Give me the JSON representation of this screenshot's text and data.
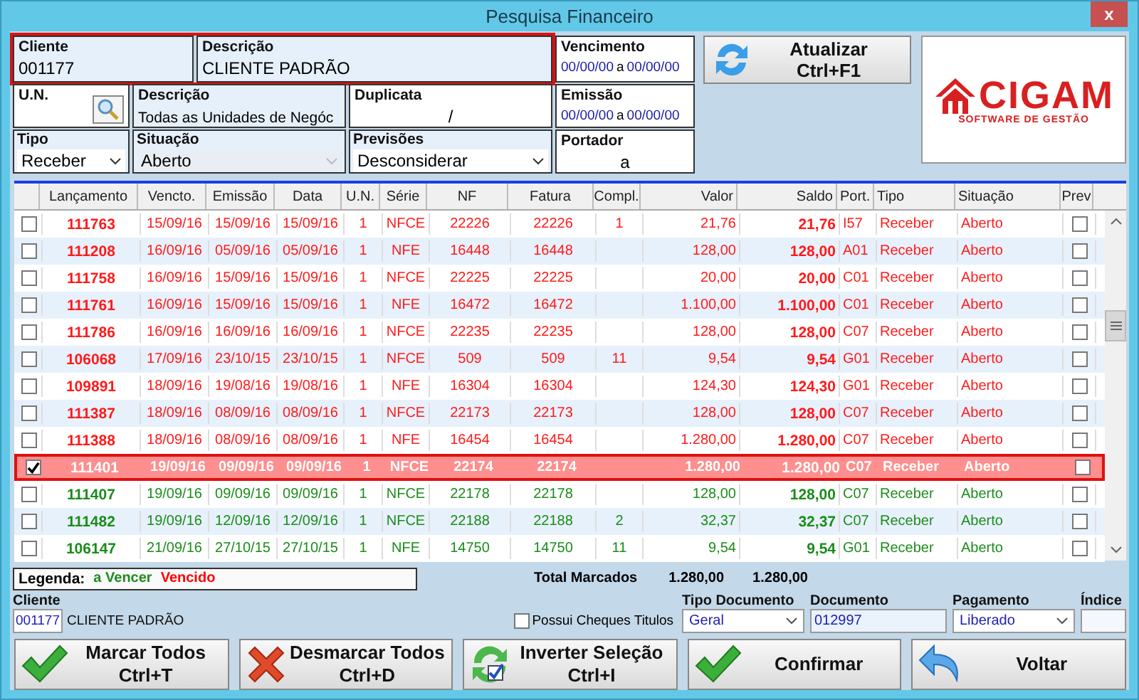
{
  "window": {
    "title": "Pesquisa Financeiro",
    "close": "x"
  },
  "filters": {
    "cliente": {
      "label": "Cliente",
      "value": "001177",
      "highlighted": true
    },
    "descricao": {
      "label": "Descrição",
      "value": "CLIENTE PADRÃO"
    },
    "vencimento": {
      "label": "Vencimento",
      "from": "00/00/00",
      "sep": "a",
      "to": "00/00/00"
    },
    "un": {
      "label": "U.N."
    },
    "un_descricao": {
      "label": "Descrição",
      "value": "Todas as Unidades de Negóc"
    },
    "duplicata": {
      "label": "Duplicata",
      "value": "/"
    },
    "emissao": {
      "label": "Emissão",
      "from": "00/00/00",
      "sep": "a",
      "to": "00/00/00"
    },
    "tipo": {
      "label": "Tipo",
      "value": "Receber",
      "disabled": false
    },
    "situacao": {
      "label": "Situação",
      "value": "Aberto",
      "disabled": true
    },
    "previsoes": {
      "label": "Previsões",
      "value": "Desconsiderar",
      "disabled": false
    },
    "portador": {
      "label": "Portador",
      "value": "a"
    }
  },
  "refresh_button": {
    "label": "Atualizar",
    "shortcut": "Ctrl+F1"
  },
  "logo": {
    "name": "CIGAM",
    "tagline": "SOFTWARE DE GESTÃO"
  },
  "table": {
    "columns": [
      "Lançamento",
      "Vencto.",
      "Emissão",
      "Data",
      "U.N.",
      "Série",
      "NF",
      "Fatura",
      "Compl.",
      "Valor",
      "Saldo",
      "Port.",
      "Tipo",
      "Situação",
      "Prev"
    ],
    "rows": [
      {
        "checked": false,
        "selected": false,
        "highlighted": false,
        "kind": "vencido",
        "prev": false,
        "cells": [
          "111763",
          "15/09/16",
          "15/09/16",
          "15/09/16",
          "1",
          "NFCE",
          "22226",
          "22226",
          "1",
          "21,76",
          "21,76",
          "I57",
          "Receber",
          "Aberto"
        ]
      },
      {
        "checked": false,
        "selected": false,
        "highlighted": false,
        "kind": "vencido",
        "prev": false,
        "cells": [
          "111208",
          "16/09/16",
          "05/09/16",
          "05/09/16",
          "1",
          "NFE",
          "16448",
          "16448",
          "",
          "128,00",
          "128,00",
          "A01",
          "Receber",
          "Aberto"
        ]
      },
      {
        "checked": false,
        "selected": false,
        "highlighted": false,
        "kind": "vencido",
        "prev": false,
        "cells": [
          "111758",
          "16/09/16",
          "15/09/16",
          "15/09/16",
          "1",
          "NFCE",
          "22225",
          "22225",
          "",
          "20,00",
          "20,00",
          "C01",
          "Receber",
          "Aberto"
        ]
      },
      {
        "checked": false,
        "selected": false,
        "highlighted": false,
        "kind": "vencido",
        "prev": false,
        "cells": [
          "111761",
          "16/09/16",
          "15/09/16",
          "15/09/16",
          "1",
          "NFE",
          "16472",
          "16472",
          "",
          "1.100,00",
          "1.100,00",
          "C01",
          "Receber",
          "Aberto"
        ]
      },
      {
        "checked": false,
        "selected": false,
        "highlighted": false,
        "kind": "vencido",
        "prev": false,
        "cells": [
          "111786",
          "16/09/16",
          "16/09/16",
          "16/09/16",
          "1",
          "NFCE",
          "22235",
          "22235",
          "",
          "128,00",
          "128,00",
          "C07",
          "Receber",
          "Aberto"
        ]
      },
      {
        "checked": false,
        "selected": false,
        "highlighted": false,
        "kind": "vencido",
        "prev": false,
        "cells": [
          "106068",
          "17/09/16",
          "23/10/15",
          "23/10/15",
          "1",
          "NFCE",
          "509",
          "509",
          "11",
          "9,54",
          "9,54",
          "G01",
          "Receber",
          "Aberto"
        ]
      },
      {
        "checked": false,
        "selected": false,
        "highlighted": false,
        "kind": "vencido",
        "prev": false,
        "cells": [
          "109891",
          "18/09/16",
          "19/08/16",
          "19/08/16",
          "1",
          "NFE",
          "16304",
          "16304",
          "",
          "124,30",
          "124,30",
          "G01",
          "Receber",
          "Aberto"
        ]
      },
      {
        "checked": false,
        "selected": false,
        "highlighted": false,
        "kind": "vencido",
        "prev": false,
        "cells": [
          "111387",
          "18/09/16",
          "08/09/16",
          "08/09/16",
          "1",
          "NFCE",
          "22173",
          "22173",
          "",
          "128,00",
          "128,00",
          "C07",
          "Receber",
          "Aberto"
        ]
      },
      {
        "checked": false,
        "selected": false,
        "highlighted": false,
        "kind": "vencido",
        "prev": false,
        "cells": [
          "111388",
          "18/09/16",
          "08/09/16",
          "08/09/16",
          "1",
          "NFE",
          "16454",
          "16454",
          "",
          "1.280,00",
          "1.280,00",
          "C07",
          "Receber",
          "Aberto"
        ]
      },
      {
        "checked": true,
        "selected": true,
        "highlighted": true,
        "kind": "a_vencer",
        "prev": false,
        "cells": [
          "111401",
          "19/09/16",
          "09/09/16",
          "09/09/16",
          "1",
          "NFCE",
          "22174",
          "22174",
          "",
          "1.280,00",
          "1.280,00",
          "C07",
          "Receber",
          "Aberto"
        ]
      },
      {
        "checked": false,
        "selected": false,
        "highlighted": false,
        "kind": "a_vencer",
        "prev": false,
        "cells": [
          "111407",
          "19/09/16",
          "09/09/16",
          "09/09/16",
          "1",
          "NFCE",
          "22178",
          "22178",
          "",
          "128,00",
          "128,00",
          "C07",
          "Receber",
          "Aberto"
        ]
      },
      {
        "checked": false,
        "selected": false,
        "highlighted": false,
        "kind": "a_vencer",
        "prev": false,
        "cells": [
          "111482",
          "19/09/16",
          "12/09/16",
          "12/09/16",
          "1",
          "NFCE",
          "22188",
          "22188",
          "2",
          "32,37",
          "32,37",
          "C07",
          "Receber",
          "Aberto"
        ]
      },
      {
        "checked": false,
        "selected": false,
        "highlighted": false,
        "kind": "a_vencer",
        "prev": false,
        "cells": [
          "106147",
          "21/09/16",
          "27/10/15",
          "27/10/15",
          "1",
          "NFE",
          "14750",
          "14750",
          "11",
          "9,54",
          "9,54",
          "G01",
          "Receber",
          "Aberto"
        ]
      }
    ]
  },
  "legend": {
    "label": "Legenda:",
    "items": [
      {
        "text": "a Vencer",
        "color": "#1e8c1e"
      },
      {
        "text": "Vencido",
        "color": "#ff0000"
      }
    ]
  },
  "totals": {
    "label": "Total Marcados",
    "valor": "1.280,00",
    "saldo": "1.280,00"
  },
  "footer": {
    "cliente_label": "Cliente",
    "cliente_code": "001177",
    "cliente_name": "CLIENTE PADRÃO",
    "cheques": {
      "label": "Possui Cheques Titulos",
      "checked": false
    },
    "tipo_documento": {
      "label": "Tipo Documento",
      "value": "Geral"
    },
    "documento": {
      "label": "Documento",
      "value": "012997"
    },
    "pagamento": {
      "label": "Pagamento",
      "value": "Liberado"
    },
    "indice": {
      "label": "Índice"
    }
  },
  "buttons": [
    {
      "kind": "check",
      "label": "Marcar Todos",
      "shortcut": "Ctrl+T"
    },
    {
      "kind": "cross",
      "label": "Desmarcar Todos",
      "shortcut": "Ctrl+D"
    },
    {
      "kind": "invert",
      "label": "Inverter Seleção",
      "shortcut": "Ctrl+I"
    },
    {
      "kind": "check",
      "label": "Confirmar"
    },
    {
      "kind": "undo",
      "label": "Voltar"
    }
  ]
}
